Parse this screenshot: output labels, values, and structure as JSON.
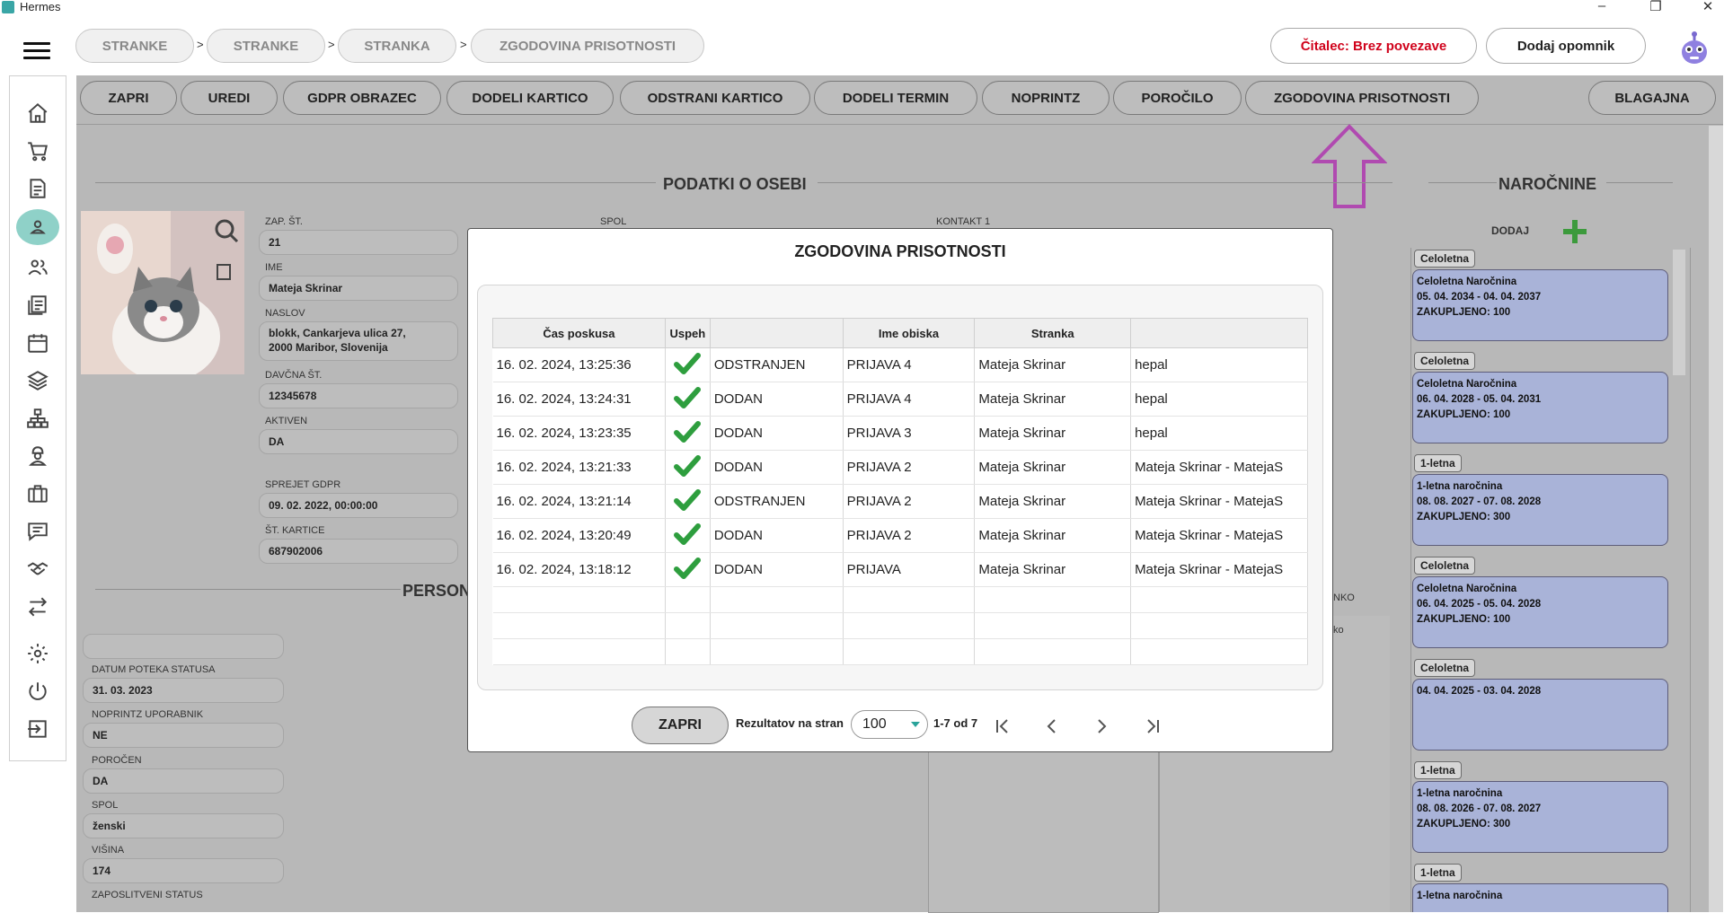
{
  "window": {
    "title": "Hermes",
    "controls": [
      "–",
      "❐",
      "✕"
    ]
  },
  "breadcrumb": [
    "STRANKE",
    "STRANKE",
    "STRANKA",
    "ZGODOVINA PRISOTNOSTI"
  ],
  "breadcrumb_sep": ">",
  "header": {
    "reader_status": "Čitalec: Brez povezave",
    "reminder_button": "Dodaj opomnik"
  },
  "toolbar": [
    "ZAPRI",
    "UREDI",
    "GDPR OBRAZEC",
    "DODELI KARTICO",
    "ODSTRANI KARTICO",
    "DODELI TERMIN",
    "NOPRINTZ",
    "POROČILO",
    "ZGODOVINA PRISOTNOSTI",
    "BLAGAJNA"
  ],
  "person": {
    "section_title": "PODATKI O OSEBI",
    "fields": [
      {
        "label": "ZAP. ŠT.",
        "value": "21"
      },
      {
        "label": "IME",
        "value": "Mateja Skrinar"
      },
      {
        "label": "NASLOV",
        "value": "blokk, Cankarjeva ulica 27,\n2000 Maribor, Slovenija"
      },
      {
        "label": "DAVČNA ŠT.",
        "value": "12345678"
      },
      {
        "label": "AKTIVEN",
        "value": "DA"
      },
      {
        "label": "SPREJET GDPR",
        "value": "09. 02. 2022, 00:00:00"
      },
      {
        "label": "ŠT. KARTICE",
        "value": "687902006"
      }
    ],
    "spol_label": "SPOL",
    "kontakt_label": "KONTAKT 1"
  },
  "personal": {
    "section_title_partial": "PERSON",
    "fields": [
      {
        "label": "",
        "value": ""
      },
      {
        "label": "DATUM POTEKA STATUSA",
        "value": "31. 03. 2023"
      },
      {
        "label": "NOPRINTZ UPORABNIK",
        "value": "NE"
      },
      {
        "label": "POROČEN",
        "value": "DA"
      },
      {
        "label": "SPOL",
        "value": "ženski"
      },
      {
        "label": "VIŠINA",
        "value": "174"
      },
      {
        "label": "ZAPOSLITVENI STATUS",
        "value": ""
      }
    ],
    "partial_label": "NKO",
    "partial_header": "ko"
  },
  "subscriptions": {
    "section_title": "NAROČNINE",
    "add_label": "DODAJ",
    "items": [
      {
        "tag": "Celoletna",
        "name": "Celoletna Naročnina",
        "period": "05. 04. 2034 - 04. 04. 2037",
        "purchased": "ZAKUPLJENO: 100"
      },
      {
        "tag": "Celoletna",
        "name": "Celoletna Naročnina",
        "period": "06. 04. 2028 - 05. 04. 2031",
        "purchased": "ZAKUPLJENO: 100"
      },
      {
        "tag": "1-letna",
        "name": "1-letna naročnina",
        "period": "08. 08. 2027 - 07. 08. 2028",
        "purchased": "ZAKUPLJENO: 300"
      },
      {
        "tag": "Celoletna",
        "name": "Celoletna Naročnina",
        "period": "06. 04. 2025 - 05. 04. 2028",
        "purchased": "ZAKUPLJENO: 100"
      },
      {
        "tag": "Celoletna",
        "name": "04. 04. 2025 - 03. 04. 2028",
        "period": "",
        "purchased": ""
      },
      {
        "tag": "1-letna",
        "name": "1-letna naročnina",
        "period": "08. 08. 2026 - 07. 08. 2027",
        "purchased": "ZAKUPLJENO: 300"
      },
      {
        "tag": "1-letna",
        "name": "1-letna naročnina",
        "period": "",
        "purchased": ""
      }
    ]
  },
  "modal": {
    "title": "ZGODOVINA PRISOTNOSTI",
    "columns": [
      "Čas poskusa",
      "Uspeh",
      "",
      "Ime obiska",
      "Stranka",
      ""
    ],
    "rows": [
      {
        "time": "16. 02. 2024, 13:25:36",
        "success": true,
        "action": "ODSTRANJEN",
        "visit": "PRIJAVA 4",
        "client": "Mateja Skrinar",
        "extra": "hepal"
      },
      {
        "time": "16. 02. 2024, 13:24:31",
        "success": true,
        "action": "DODAN",
        "visit": "PRIJAVA 4",
        "client": "Mateja Skrinar",
        "extra": "hepal"
      },
      {
        "time": "16. 02. 2024, 13:23:35",
        "success": true,
        "action": "DODAN",
        "visit": "PRIJAVA 3",
        "client": "Mateja Skrinar",
        "extra": "hepal"
      },
      {
        "time": "16. 02. 2024, 13:21:33",
        "success": true,
        "action": "DODAN",
        "visit": "PRIJAVA 2",
        "client": "Mateja Skrinar",
        "extra": "Mateja Skrinar - MatejaS"
      },
      {
        "time": "16. 02. 2024, 13:21:14",
        "success": true,
        "action": "ODSTRANJEN",
        "visit": "PRIJAVA 2",
        "client": "Mateja Skrinar",
        "extra": "Mateja Skrinar - MatejaS"
      },
      {
        "time": "16. 02. 2024, 13:20:49",
        "success": true,
        "action": "DODAN",
        "visit": "PRIJAVA 2",
        "client": "Mateja Skrinar",
        "extra": "Mateja Skrinar - MatejaS"
      },
      {
        "time": "16. 02. 2024, 13:18:12",
        "success": true,
        "action": "DODAN",
        "visit": "PRIJAVA",
        "client": "Mateja Skrinar",
        "extra": "Mateja Skrinar - MatejaS"
      }
    ],
    "close_button": "ZAPRI",
    "per_page_label": "Rezultatov na stran",
    "per_page_value": "100",
    "range_text": "1-7 od 7"
  },
  "colors": {
    "accent": "#8fd1c8",
    "reader_status": "#d0021b",
    "arrow": "#b04ab0",
    "check": "#2e9e3e",
    "subscription_card": "#a9b3d8"
  },
  "icons": [
    "home-icon",
    "cart-icon",
    "document-icon",
    "person-icon",
    "group-icon",
    "list-icon",
    "calendar-icon",
    "layers-icon",
    "network-icon",
    "worker-icon",
    "briefcase-icon",
    "chat-icon",
    "handshake-icon",
    "transfer-icon",
    "gear-icon",
    "power-icon",
    "logout-icon"
  ]
}
